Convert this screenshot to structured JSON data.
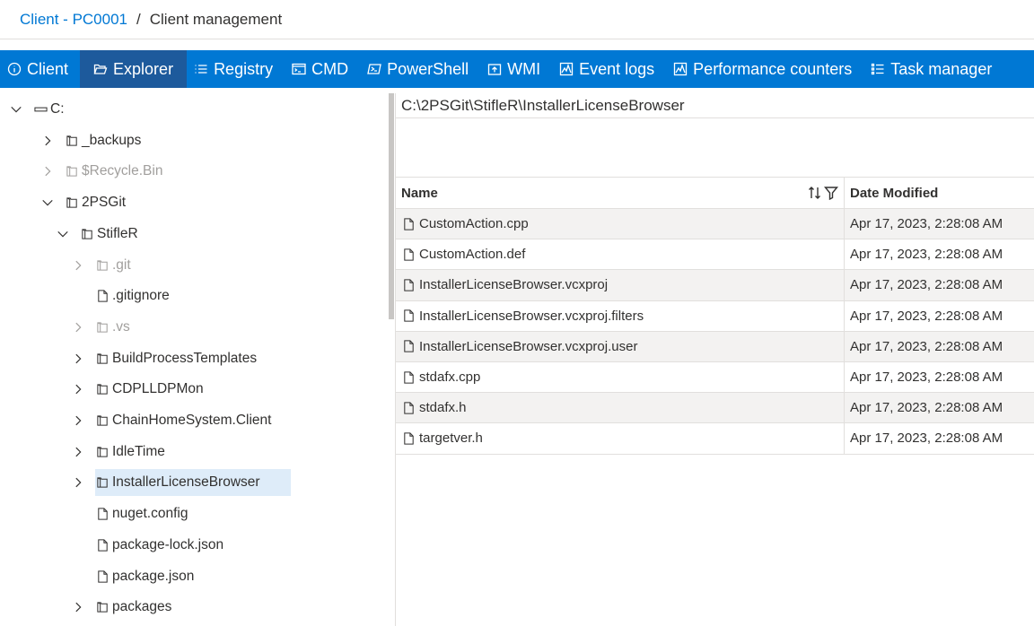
{
  "breadcrumb": {
    "link": "Client - PC0001",
    "separator": "/",
    "current": "Client management"
  },
  "tabs": [
    {
      "label": "Client",
      "icon": "info-icon"
    },
    {
      "label": "Explorer",
      "icon": "folder-open-icon"
    },
    {
      "label": "Registry",
      "icon": "list-icon"
    },
    {
      "label": "CMD",
      "icon": "cmd-icon"
    },
    {
      "label": "PowerShell",
      "icon": "powershell-icon"
    },
    {
      "label": "WMI",
      "icon": "wmi-icon"
    },
    {
      "label": "Event logs",
      "icon": "event-log-icon"
    },
    {
      "label": "Performance counters",
      "icon": "performance-icon"
    },
    {
      "label": "Task manager",
      "icon": "task-list-icon"
    }
  ],
  "active_tab": "Explorer",
  "tree": [
    {
      "label": "C:",
      "kind": "drive",
      "expanded": true,
      "dim": false
    },
    {
      "label": "_backups",
      "kind": "folder",
      "expanded": false,
      "dim": false
    },
    {
      "label": "$Recycle.Bin",
      "kind": "folder",
      "expanded": false,
      "dim": true
    },
    {
      "label": "2PSGit",
      "kind": "folder",
      "expanded": true,
      "dim": false
    },
    {
      "label": "StifleR",
      "kind": "folder",
      "expanded": true,
      "dim": false
    },
    {
      "label": ".git",
      "kind": "folder",
      "expanded": false,
      "dim": true
    },
    {
      "label": ".gitignore",
      "kind": "file",
      "dim": false
    },
    {
      "label": ".vs",
      "kind": "folder",
      "expanded": false,
      "dim": true
    },
    {
      "label": "BuildProcessTemplates",
      "kind": "folder",
      "expanded": false,
      "dim": false
    },
    {
      "label": "CDPLLDPMon",
      "kind": "folder",
      "expanded": false,
      "dim": false
    },
    {
      "label": "ChainHomeSystem.Client",
      "kind": "folder",
      "expanded": false,
      "dim": false
    },
    {
      "label": "IdleTime",
      "kind": "folder",
      "expanded": false,
      "dim": false
    },
    {
      "label": "InstallerLicenseBrowser",
      "kind": "folder",
      "expanded": false,
      "dim": false,
      "selected": true
    },
    {
      "label": "nuget.config",
      "kind": "file",
      "dim": false
    },
    {
      "label": "package-lock.json",
      "kind": "file",
      "dim": false
    },
    {
      "label": "package.json",
      "kind": "file",
      "dim": false
    },
    {
      "label": "packages",
      "kind": "folder",
      "expanded": false,
      "dim": false
    }
  ],
  "path": "C:\\2PSGit\\StifleR\\InstallerLicenseBrowser",
  "grid": {
    "columns": {
      "name": "Name",
      "date": "Date Modified"
    },
    "rows": [
      {
        "name": "CustomAction.cpp",
        "date": "Apr 17, 2023, 2:28:08 AM"
      },
      {
        "name": "CustomAction.def",
        "date": "Apr 17, 2023, 2:28:08 AM"
      },
      {
        "name": "InstallerLicenseBrowser.vcxproj",
        "date": "Apr 17, 2023, 2:28:08 AM"
      },
      {
        "name": "InstallerLicenseBrowser.vcxproj.filters",
        "date": "Apr 17, 2023, 2:28:08 AM"
      },
      {
        "name": "InstallerLicenseBrowser.vcxproj.user",
        "date": "Apr 17, 2023, 2:28:08 AM"
      },
      {
        "name": "stdafx.cpp",
        "date": "Apr 17, 2023, 2:28:08 AM"
      },
      {
        "name": "stdafx.h",
        "date": "Apr 17, 2023, 2:28:08 AM"
      },
      {
        "name": "targetver.h",
        "date": "Apr 17, 2023, 2:28:08 AM"
      }
    ]
  },
  "colors": {
    "accent": "#0078d4",
    "active_tab": "#1d5a9c",
    "selected_row": "#deecf9",
    "alt_row": "#f3f2f1"
  }
}
